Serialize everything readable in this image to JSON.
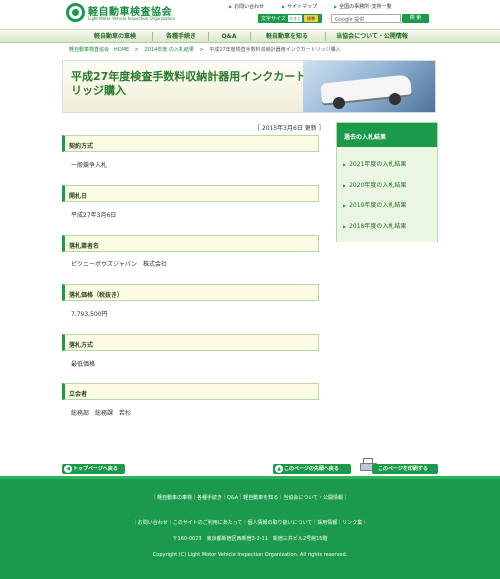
{
  "header": {
    "logo_ja": "軽自動車検査協会",
    "logo_en": "Light Motor Vehicle Inspection Organization",
    "links": [
      "お問い合わせ",
      "サイトマップ",
      "全国の事務所･支所一覧"
    ],
    "font_size_label": "文字サイズ",
    "font_large": "大きく",
    "font_standard": "標準",
    "search_placeholder": "Google 提供",
    "search_button": "検 索"
  },
  "nav": {
    "items": [
      "軽自動車の車検",
      "各種手続き",
      "Q&A",
      "軽自動車を知る",
      "当協会について・公開情報"
    ]
  },
  "breadcrumb": {
    "home": "軽自動車検査協会　HOME",
    "sep": ">",
    "parent": "2014年度 の入札結果",
    "current": "平成27年度検査手数料収納計器用インクカートリッジ購入"
  },
  "hero": {
    "title": "平成27年度検査手数料収納計器用インクカートリッジ購入"
  },
  "main": {
    "date": "［ 2015年3月6日 更新 ］",
    "sections": [
      {
        "heading": "契約方式",
        "value": "一般競争入札"
      },
      {
        "heading": "開札日",
        "value": "平成27年3月6日"
      },
      {
        "heading": "落札業者名",
        "value": "ピツニーボウズジャパン　株式会社"
      },
      {
        "heading": "落札価格（税抜き）",
        "value": "7,793,500円"
      },
      {
        "heading": "落札方式",
        "value": "最低価格"
      },
      {
        "heading": "立会者",
        "value": "総務部　総務課　若杉"
      }
    ]
  },
  "sidebar": {
    "title": "過去の入札結果",
    "items": [
      "2021年度の入札結果",
      "2020年度の入札結果",
      "2019年度の入札結果",
      "2018年度の入札結果"
    ]
  },
  "page_controls": {
    "back_to_top": "トップページへ戻る",
    "back_to_head": "このページの先頭へ戻る",
    "print": "このページを印刷する"
  },
  "footer": {
    "nav_links": "｜軽自動車の車検｜各種手続き｜Q&A｜軽自動車を知る｜当協会について・公開情報｜",
    "util_links": "｜お問い合わせ｜このサイトのご利用にあたって｜個人情報の取り扱いについて｜採用情報｜リンク集｜",
    "address": "〒160-0023　東京都新宿区西新宿3-2-11　新宿三井ビル2号館15階",
    "copyright": "Copyright (C) Light Motor Vehicle Inspection Organization. All rights reserved."
  },
  "colors": {
    "brand_green": "#1a9a4a",
    "section_bg": "#fcfbe4",
    "sidebar_bg": "#eaf6e2"
  }
}
